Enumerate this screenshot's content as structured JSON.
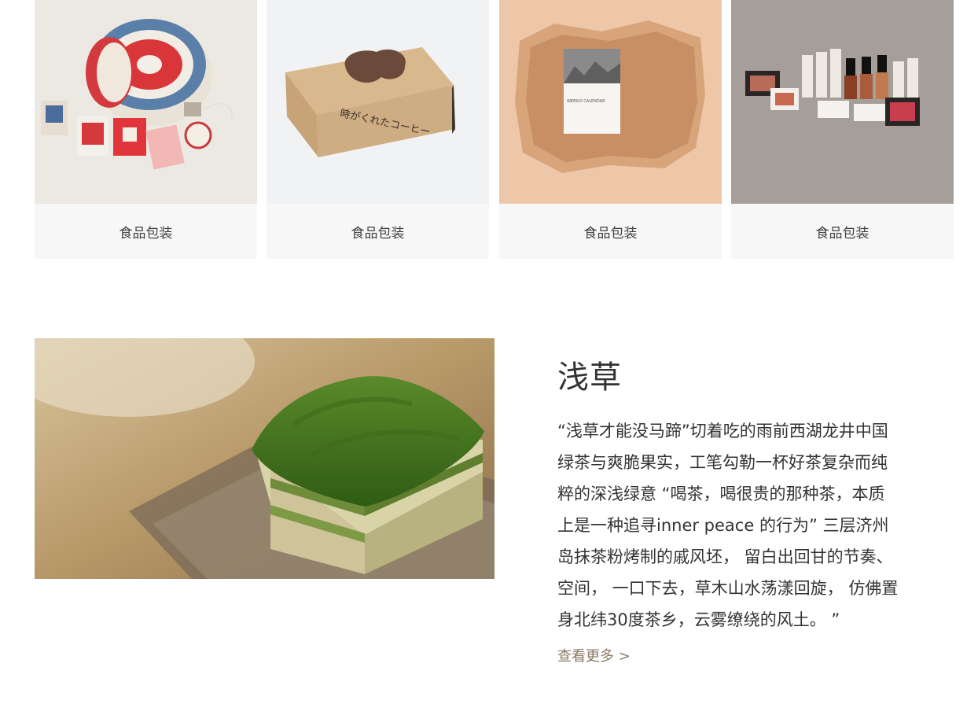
{
  "products": [
    {
      "caption": "食品包装",
      "image": "zodiac-tea-tin-packaging"
    },
    {
      "caption": "食品包装",
      "image": "kraft-coffee-box-packaging"
    },
    {
      "caption": "食品包装",
      "image": "weekly-calendar-paper-packaging"
    },
    {
      "caption": "食品包装",
      "image": "cosmetics-set-packaging"
    }
  ],
  "feature": {
    "title": "浅草",
    "body": "“浅草才能没马蹄”切着吃的雨前西湖龙井中国绿茶与爽脆果实，工笔勾勒一杯好茶复杂而纯粹的深浅绿意 “喝茶，喝很贵的那种茶，本质上是一种追寻inner peace 的行为” 三层济州岛抹茶粉烤制的戚风坯， 留白出回甘的节奏、空间， 一口下去，草木山水荡漾回旋， 仿佛置身北纬30度茶乡，云雾缭绕的风土。 ”",
    "read_more": "查看更多 >",
    "image": "matcha-cake-photo"
  },
  "colors": {
    "card_bg": "#f7f7f7",
    "text": "#333333",
    "link": "#8a7a66"
  }
}
